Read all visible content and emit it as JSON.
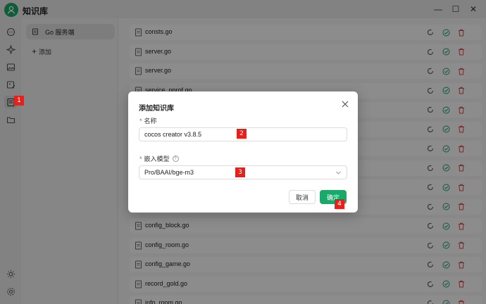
{
  "app": {
    "title": "知识库"
  },
  "window_controls": {
    "minimize": "—",
    "maximize": "☐",
    "close": "✕"
  },
  "sidebar": {
    "kb_item_label": "Go 服务端",
    "add_label": "添加"
  },
  "files": [
    "consts.go",
    "server.go",
    "server.go",
    "service_pprof.go",
    "",
    "",
    "",
    "",
    "",
    "",
    "config_block.go",
    "config_room.go",
    "config_game.go",
    "record_gold.go",
    "info_room.go"
  ],
  "modal": {
    "title": "添加知识库",
    "name_label": "名称",
    "name_value": "cocos creator v3.8.5",
    "model_label": "嵌入模型",
    "help_glyph": "?",
    "model_value": "Pro/BAAI/bge-m3",
    "cancel_label": "取消",
    "ok_label": "确定"
  },
  "badges": [
    "1",
    "2",
    "3",
    "4"
  ],
  "colors": {
    "accent": "#1aa96b",
    "danger": "#e04848",
    "badge": "#e8201c"
  }
}
